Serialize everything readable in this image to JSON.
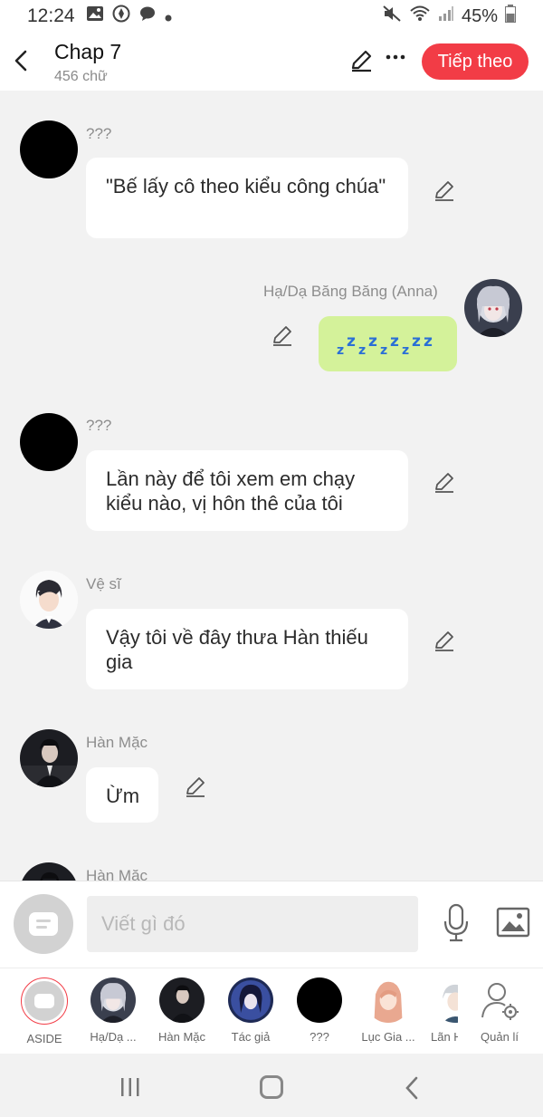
{
  "status_bar": {
    "time": "12:24",
    "battery": "45%"
  },
  "header": {
    "title": "Chap 7",
    "subtitle": "456 chữ",
    "next_label": "Tiếp theo"
  },
  "messages": [
    {
      "sender": "???",
      "text": "\"Bế lấy cô theo kiểu công chúa\"",
      "side": "left",
      "avatar": "black"
    },
    {
      "sender": "Hạ/Dạ Băng Băng (Anna)",
      "text": "zzzzzzzz",
      "side": "right",
      "avatar": "anna"
    },
    {
      "sender": "???",
      "text": "Lần này để tôi xem em chạy kiểu nào, vị hôn thê của tôi",
      "side": "left",
      "avatar": "black"
    },
    {
      "sender": "Vệ sĩ",
      "text": "Vậy tôi về đây thưa Hàn thiếu gia",
      "side": "left",
      "avatar": "guard"
    },
    {
      "sender": "Hàn Mặc",
      "text": "Ừm",
      "side": "left",
      "avatar": "hanmac"
    },
    {
      "sender": "Hàn Mặc",
      "text": "",
      "side": "left",
      "avatar": "hanmac"
    }
  ],
  "input": {
    "placeholder": "Viết gì đó"
  },
  "characters": [
    {
      "label": "ASIDE"
    },
    {
      "label": "Hạ/Dạ ..."
    },
    {
      "label": "Hàn Mặc"
    },
    {
      "label": "Tác giả"
    },
    {
      "label": "???"
    },
    {
      "label": "Lục Gia ..."
    },
    {
      "label": "Lãn H"
    },
    {
      "label": "Quản lí"
    }
  ],
  "colors": {
    "accent": "#f23c46",
    "bubble_self": "#d4f29a",
    "background": "#f2f2f2"
  }
}
